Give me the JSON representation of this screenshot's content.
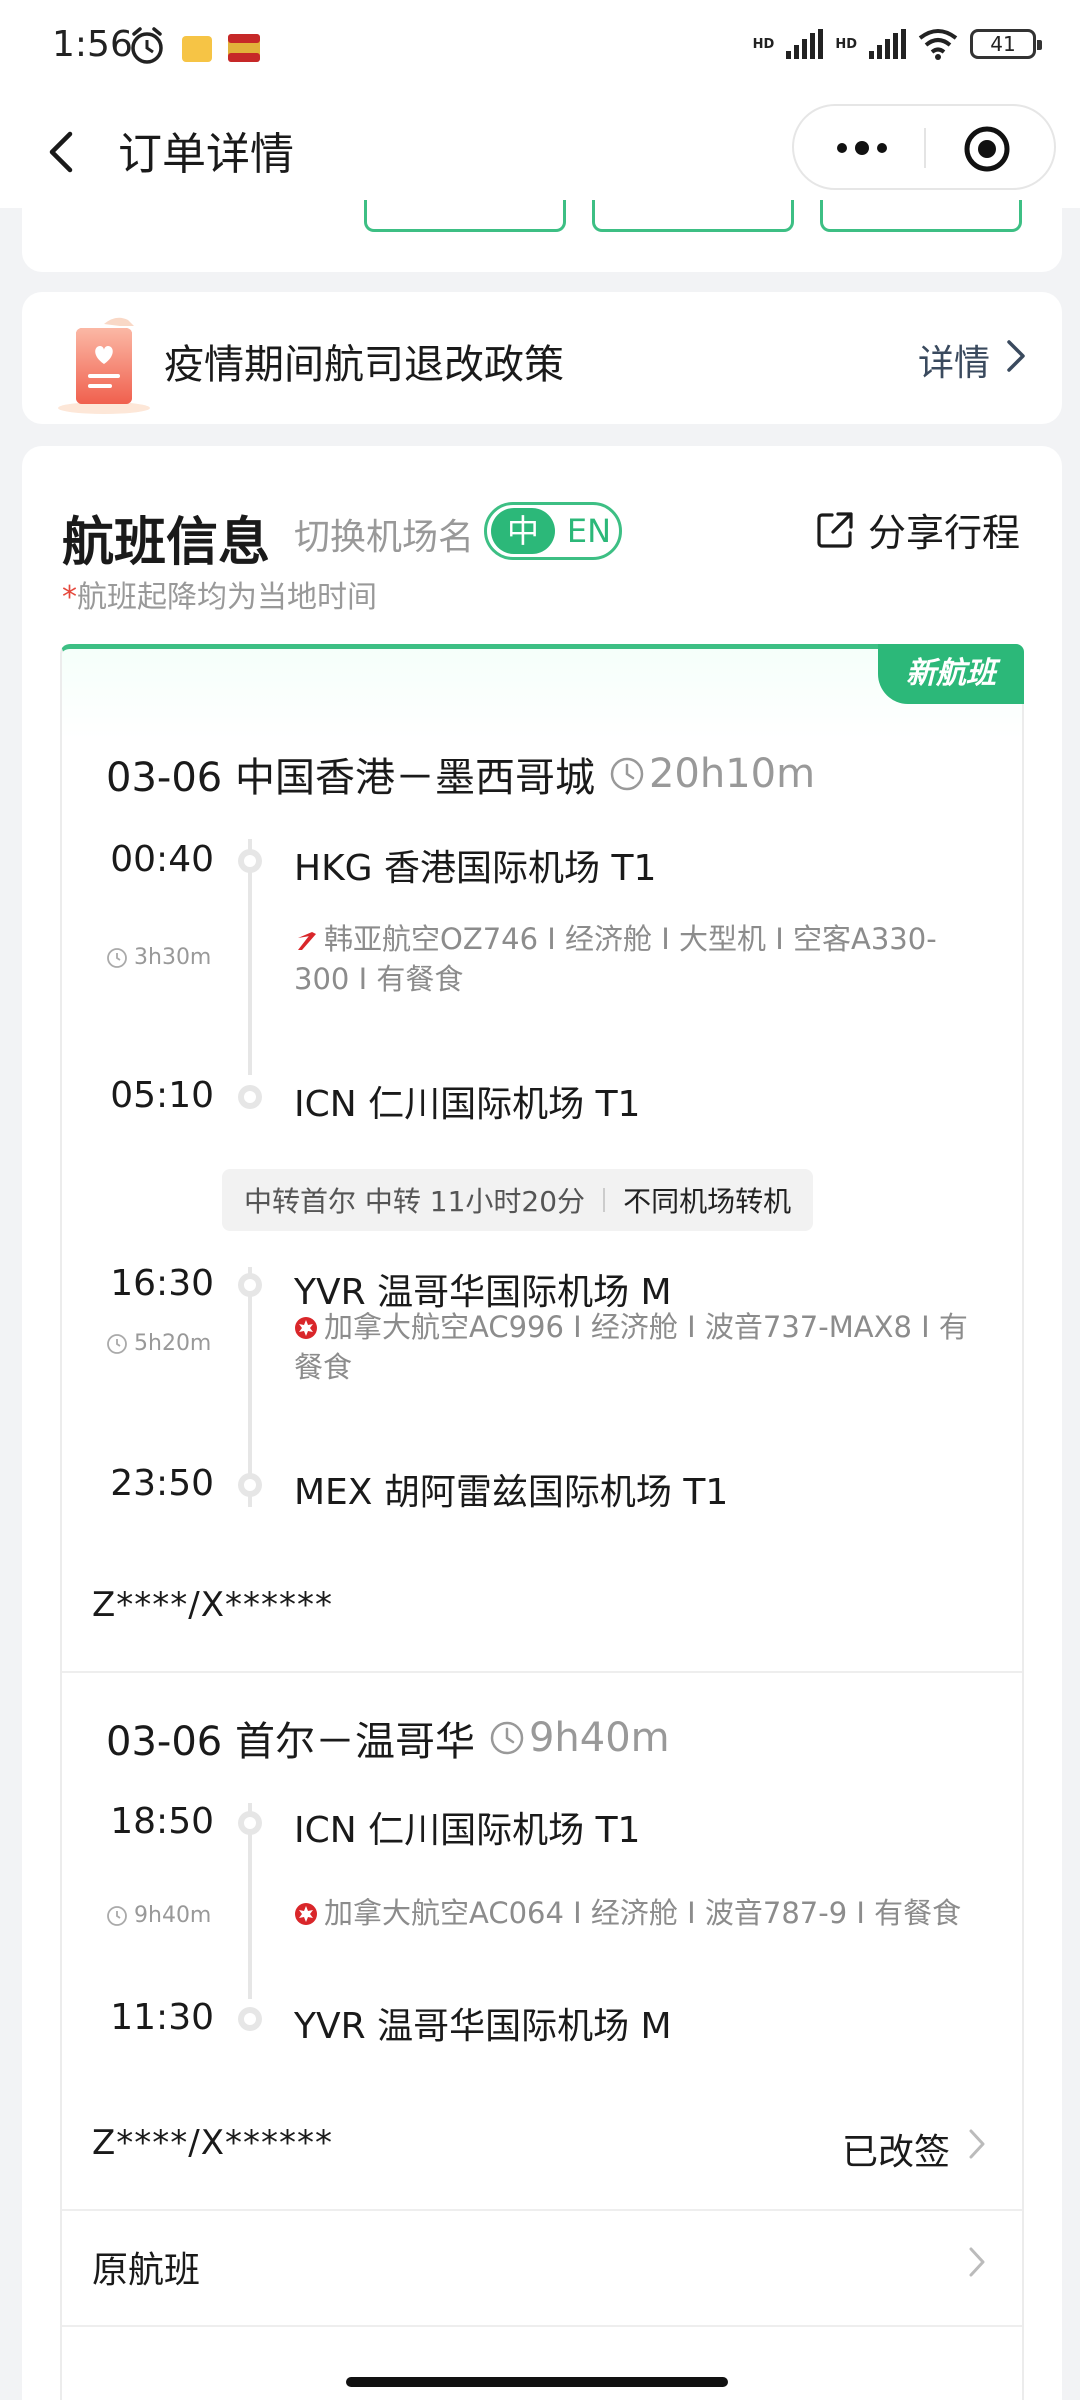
{
  "status_bar": {
    "time": "1:56",
    "battery": "41",
    "hd": "HD"
  },
  "nav": {
    "title": "订单详情"
  },
  "policy": {
    "title": "疫情期间航司退改政策",
    "detail": "详情"
  },
  "flight_info": {
    "heading": "航班信息",
    "switch_label": "切换机场名",
    "lang_zh": "中",
    "lang_en": "EN",
    "share": "分享行程",
    "note_star": "*",
    "note": "航班起降均为当地时间",
    "new_badge": "新航班"
  },
  "trip1": {
    "route": "03-06 中国香港－墨西哥城",
    "duration": "20h10m",
    "stops": [
      {
        "time": "00:40",
        "airport": "HKG 香港国际机场 T1"
      },
      {
        "time": "05:10",
        "airport": "ICN 仁川国际机场 T1"
      },
      {
        "time": "16:30",
        "airport": "YVR 温哥华国际机场 M"
      },
      {
        "time": "23:50",
        "airport": "MEX 胡阿雷兹国际机场 T1"
      }
    ],
    "legs": [
      {
        "duration": "3h30m",
        "info": "韩亚航空OZ746 I 经济舱 I 大型机 I 空客A330-300 I 有餐食",
        "logo_color": "#d9262a"
      },
      {
        "duration": "5h20m",
        "info": "加拿大航空AC996 I 经济舱 I 波音737-MAX8 I 有餐食",
        "logo_color": "#d9262a"
      }
    ],
    "transfer": {
      "text": "中转首尔 中转 11小时20分",
      "diff": "不同机场转机"
    },
    "passenger": "Z****/X******"
  },
  "trip2": {
    "route": "03-06 首尔－温哥华",
    "duration": "9h40m",
    "stops": [
      {
        "time": "18:50",
        "airport": "ICN 仁川国际机场 T1"
      },
      {
        "time": "11:30",
        "airport": "YVR 温哥华国际机场 M"
      }
    ],
    "legs": [
      {
        "duration": "9h40m",
        "info": "加拿大航空AC064 I 经济舱 I 波音787-9 I 有餐食",
        "logo_color": "#d9262a"
      }
    ],
    "passenger": "Z****/X******",
    "status": "已改签"
  },
  "original_flight": {
    "label": "原航班"
  },
  "colors": {
    "accent": "#2cb879",
    "accent_border": "#3dbf84",
    "muted": "#999999",
    "star": "#e5483c"
  }
}
